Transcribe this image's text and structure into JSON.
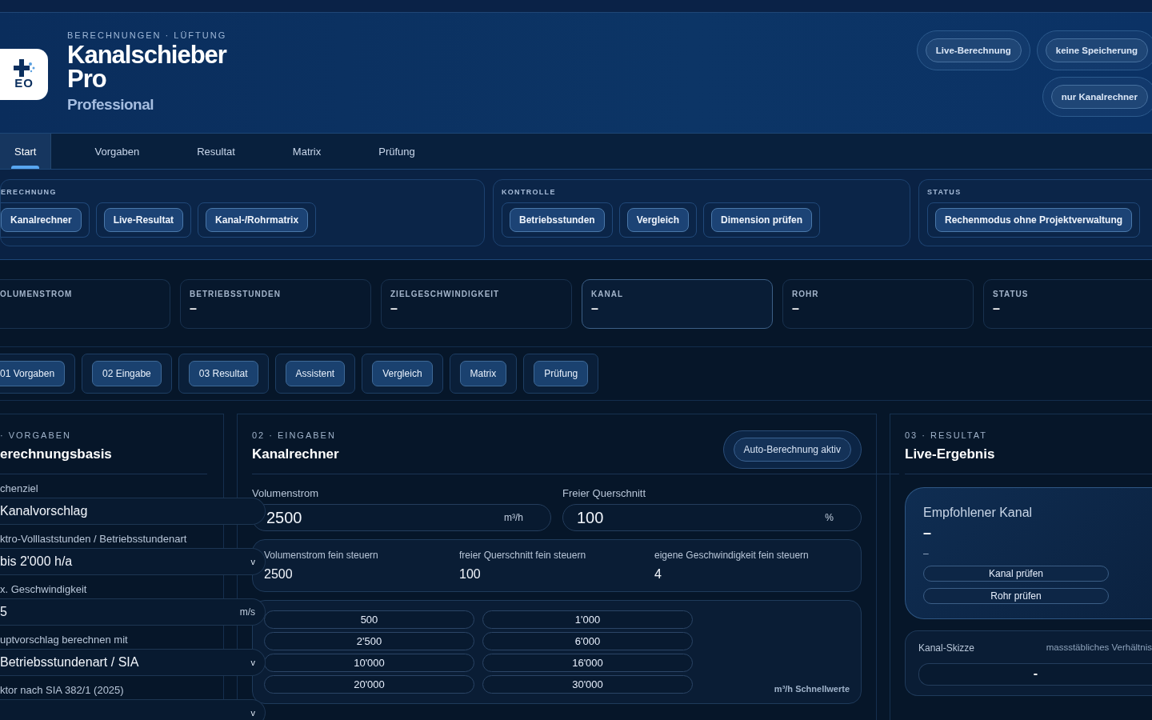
{
  "header": {
    "breadcrumb": "BERECHNUNGEN · LÜFTUNG",
    "title_line1": "Kanalschieber",
    "title_line2": "Pro",
    "edition": "Professional",
    "logo_text": "EO",
    "badges": [
      {
        "label": "Live-Berechnung"
      },
      {
        "label": "keine Speicherung"
      },
      {
        "label": "nur Kanalrechner"
      }
    ]
  },
  "tabs": [
    {
      "label": "Start",
      "selected": true
    },
    {
      "label": "Vorgaben",
      "selected": false
    },
    {
      "label": "Resultat",
      "selected": false
    },
    {
      "label": "Matrix",
      "selected": false
    },
    {
      "label": "Prüfung",
      "selected": false
    }
  ],
  "action_groups": [
    {
      "title": "ERECHNUNG",
      "buttons": [
        "Kanalrechner",
        "Live-Resultat",
        "Kanal-/Rohrmatrix"
      ]
    },
    {
      "title": "KONTROLLE",
      "buttons": [
        "Betriebsstunden",
        "Vergleich",
        "Dimension prüfen"
      ]
    },
    {
      "title": "STATUS",
      "buttons": [
        "Rechenmodus ohne Projektverwaltung"
      ]
    }
  ],
  "metrics": [
    {
      "label": "OLUMENSTROM",
      "highlighted": false
    },
    {
      "label": "BETRIEBSSTUNDEN",
      "value": "–",
      "highlighted": false
    },
    {
      "label": "ZIELGESCHWINDIGKEIT",
      "value": "–",
      "highlighted": false
    },
    {
      "label": "KANAL",
      "value": "–",
      "highlighted": true
    },
    {
      "label": "ROHR",
      "value": "–",
      "highlighted": false
    },
    {
      "label": "STATUS",
      "value": "–",
      "highlighted": false
    }
  ],
  "nav_chips": [
    "01 Vorgaben",
    "02 Eingabe",
    "03 Resultat",
    "Assistent",
    "Vergleich",
    "Matrix",
    "Prüfung"
  ],
  "vorgaben": {
    "section": "· VORGABEN",
    "title": "erechnungsbasis",
    "fields": [
      {
        "label": "chenziel",
        "value": "Kanalvorschlag"
      },
      {
        "label": "ktro-Volllaststunden / Betriebsstundenart",
        "value": "bis 2'000 h/a",
        "caret": "v"
      },
      {
        "label": "x. Geschwindigkeit",
        "value": "5",
        "unit": "m/s"
      },
      {
        "label": "uptvorschlag berechnen mit",
        "value": "Betriebsstundenart / SIA",
        "caret": "v"
      },
      {
        "label": "ktor nach SIA 382/1 (2025)",
        "caret": "v"
      }
    ]
  },
  "eingaben": {
    "section": "02 · EINGABEN",
    "title": "Kanalrechner",
    "auto_badge": "Auto-Berechnung aktiv",
    "inputs": [
      {
        "label": "Volumenstrom",
        "value": "2500",
        "unit": "m³/h"
      },
      {
        "label": "Freier Querschnitt",
        "value": "100",
        "unit": "%"
      }
    ],
    "fine": [
      {
        "label": "Volumenstrom fein steuern",
        "value": "2500"
      },
      {
        "label": "freier Querschnitt fein steuern",
        "value": "100"
      },
      {
        "label": "eigene Geschwindigkeit fein steuern",
        "value": "4"
      }
    ],
    "quick_values": [
      [
        "500",
        "2'500",
        "10'000",
        "20'000"
      ],
      [
        "1'000",
        "6'000",
        "16'000",
        "30'000"
      ]
    ],
    "quick_label": "m³/h Schnellwerte"
  },
  "resultat": {
    "section": "03 · RESULTAT",
    "title": "Live-Ergebnis",
    "card_title": "Empfohlener Kanal",
    "card_value": "–",
    "card_sub": "–",
    "card_buttons": [
      "Kanal prüfen",
      "Rohr prüfen"
    ],
    "sketch_title": "Kanal-Skizze",
    "sketch_note": "massstäbliches Verhältnis",
    "sketch_value": "-"
  }
}
